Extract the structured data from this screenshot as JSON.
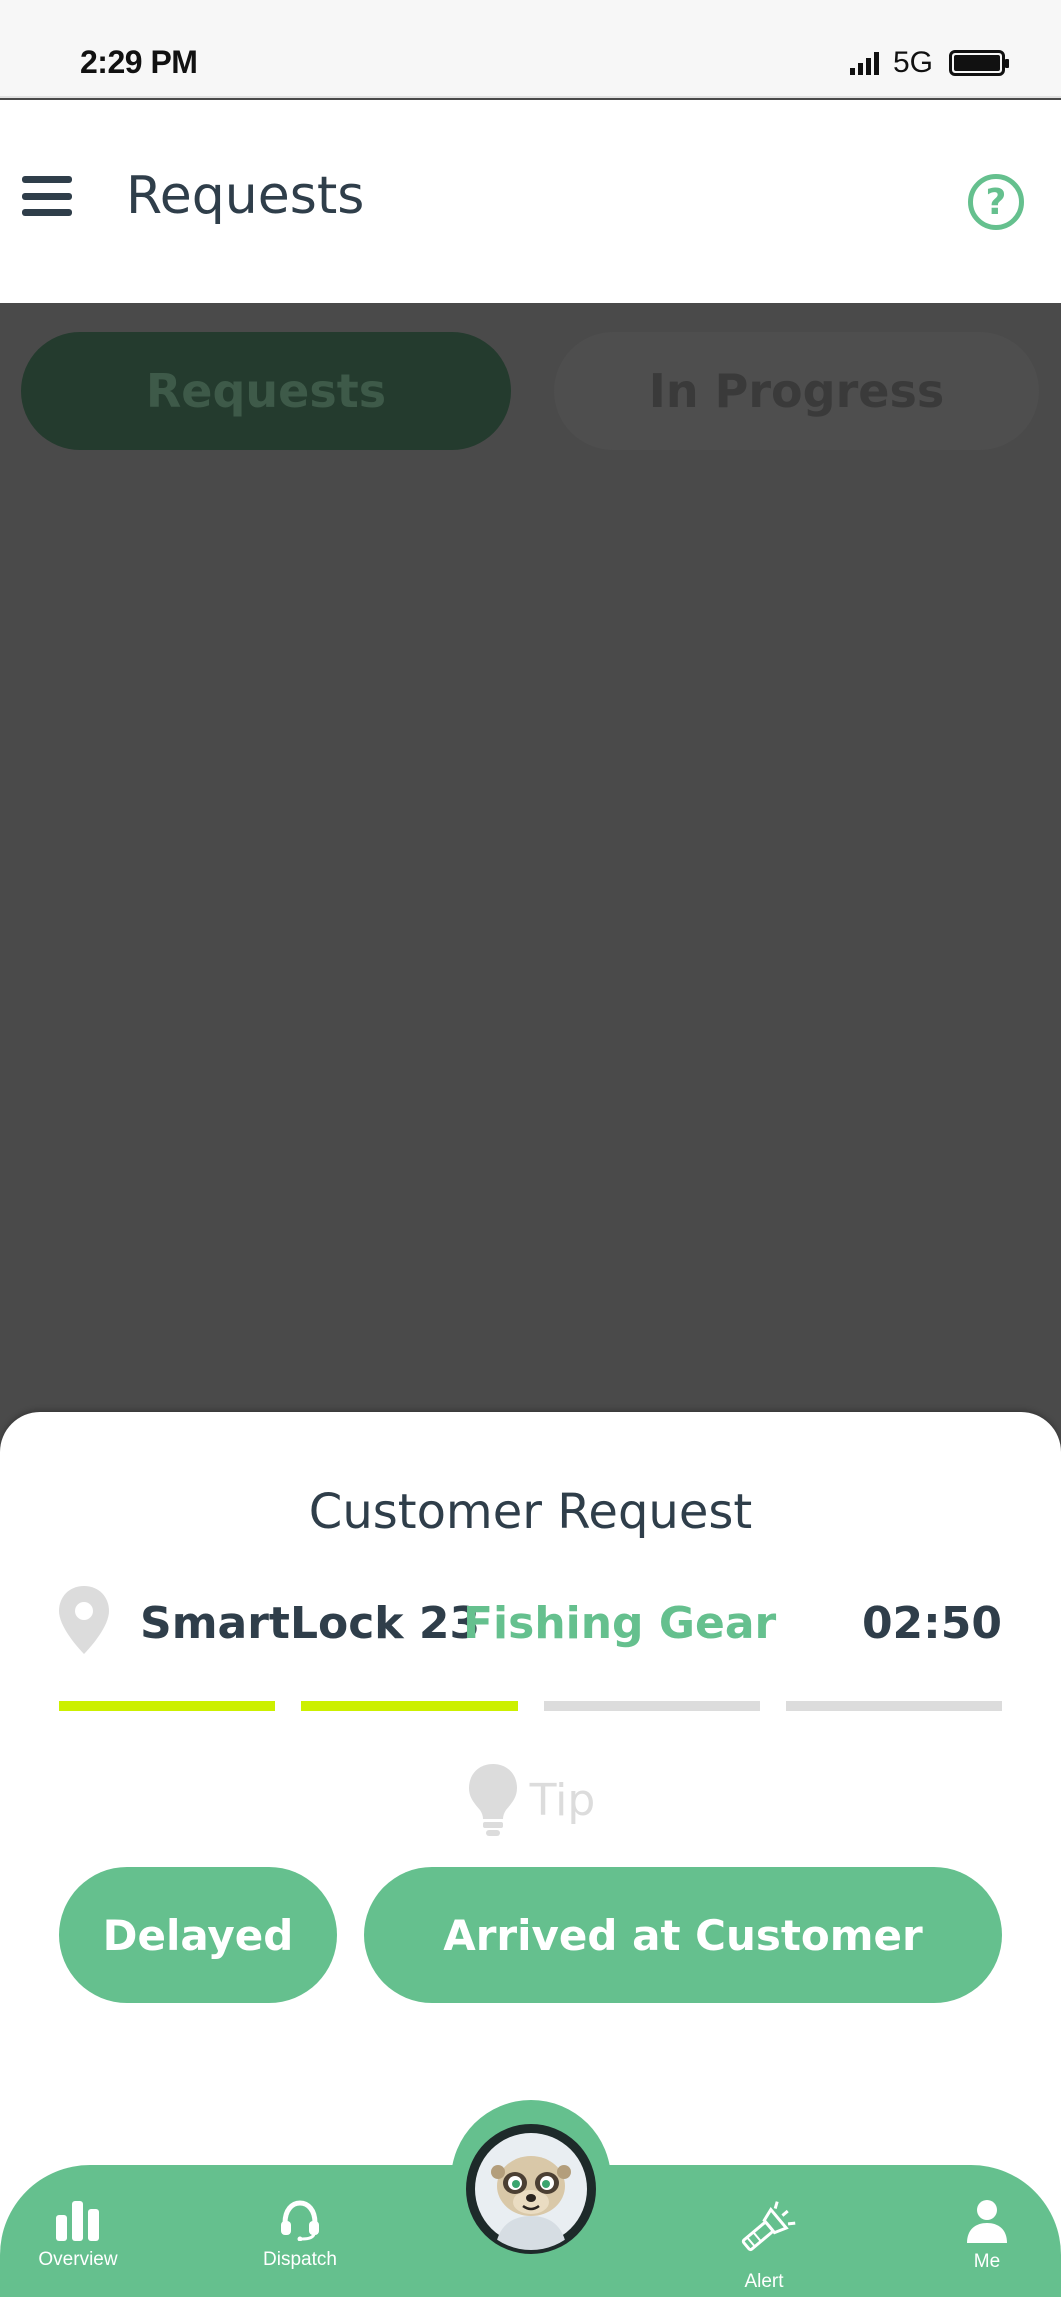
{
  "status_bar": {
    "time": "2:29 PM",
    "network": "5G"
  },
  "header": {
    "title": "Requests",
    "help_symbol": "?",
    "menu_icon": "hamburger-icon",
    "help_icon": "question-circle-icon"
  },
  "tabs": [
    {
      "label": "Requests",
      "active": true
    },
    {
      "label": "In Progress",
      "active": false
    }
  ],
  "sheet": {
    "title": "Customer Request",
    "location_icon": "map-pin-icon",
    "lock_name": "SmartLock 23",
    "category": "Fishing Gear",
    "timer": "02:50",
    "progress_steps_total": 4,
    "progress_steps_done": 2,
    "tip_icon": "lightbulb-icon",
    "tip_label": "Tip",
    "buttons": {
      "delayed": "Delayed",
      "arrived": "Arrived at Customer"
    }
  },
  "bottom_nav": [
    {
      "label": "Overview",
      "icon": "bar-chart-icon"
    },
    {
      "label": "Dispatch",
      "icon": "headset-icon"
    },
    {
      "label": "",
      "icon": "meerkat-avatar-icon"
    },
    {
      "label": "Alert",
      "icon": "flashlight-icon"
    },
    {
      "label": "Me",
      "icon": "person-icon"
    }
  ],
  "colors": {
    "accent_green": "#65c08e",
    "progress_done": "#ccf000",
    "progress_pending": "#dcdcdc",
    "text_dark": "#2f3e4a",
    "overlay": "#4a4a4a"
  }
}
